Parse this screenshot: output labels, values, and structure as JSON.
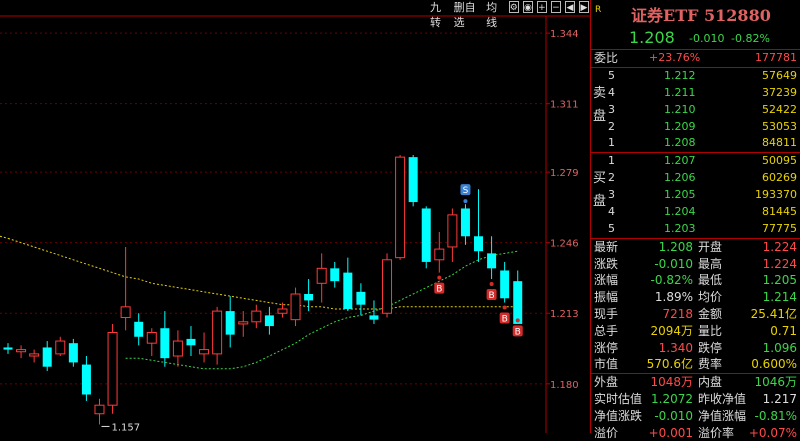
{
  "toolbar": {
    "items": [
      "九转",
      "删自选",
      "均线"
    ]
  },
  "chart_data": {
    "type": "candlestick",
    "y_ticks": [
      "1.344",
      "1.311",
      "1.279",
      "1.246",
      "1.213",
      "1.180"
    ],
    "ylim": [
      1.157,
      1.352
    ],
    "low_annotation": "1.157",
    "candles": [
      {
        "o": 1.197,
        "h": 1.199,
        "l": 1.194,
        "c": 1.196
      },
      {
        "o": 1.195,
        "h": 1.198,
        "l": 1.192,
        "c": 1.196
      },
      {
        "o": 1.193,
        "h": 1.196,
        "l": 1.19,
        "c": 1.194
      },
      {
        "o": 1.197,
        "h": 1.2,
        "l": 1.186,
        "c": 1.188
      },
      {
        "o": 1.194,
        "h": 1.202,
        "l": 1.193,
        "c": 1.2
      },
      {
        "o": 1.199,
        "h": 1.201,
        "l": 1.188,
        "c": 1.19
      },
      {
        "o": 1.189,
        "h": 1.193,
        "l": 1.172,
        "c": 1.175
      },
      {
        "o": 1.166,
        "h": 1.173,
        "l": 1.161,
        "c": 1.17
      },
      {
        "o": 1.17,
        "h": 1.208,
        "l": 1.166,
        "c": 1.204
      },
      {
        "o": 1.211,
        "h": 1.244,
        "l": 1.205,
        "c": 1.216
      },
      {
        "o": 1.209,
        "h": 1.213,
        "l": 1.198,
        "c": 1.202
      },
      {
        "o": 1.199,
        "h": 1.206,
        "l": 1.193,
        "c": 1.204
      },
      {
        "o": 1.206,
        "h": 1.214,
        "l": 1.188,
        "c": 1.192
      },
      {
        "o": 1.193,
        "h": 1.205,
        "l": 1.188,
        "c": 1.2
      },
      {
        "o": 1.201,
        "h": 1.207,
        "l": 1.193,
        "c": 1.198
      },
      {
        "o": 1.194,
        "h": 1.204,
        "l": 1.19,
        "c": 1.196
      },
      {
        "o": 1.194,
        "h": 1.216,
        "l": 1.189,
        "c": 1.214
      },
      {
        "o": 1.214,
        "h": 1.221,
        "l": 1.197,
        "c": 1.203
      },
      {
        "o": 1.208,
        "h": 1.214,
        "l": 1.202,
        "c": 1.209
      },
      {
        "o": 1.209,
        "h": 1.217,
        "l": 1.206,
        "c": 1.214
      },
      {
        "o": 1.212,
        "h": 1.216,
        "l": 1.203,
        "c": 1.207
      },
      {
        "o": 1.213,
        "h": 1.218,
        "l": 1.211,
        "c": 1.215
      },
      {
        "o": 1.21,
        "h": 1.225,
        "l": 1.207,
        "c": 1.222
      },
      {
        "o": 1.222,
        "h": 1.229,
        "l": 1.214,
        "c": 1.219
      },
      {
        "o": 1.227,
        "h": 1.241,
        "l": 1.218,
        "c": 1.234
      },
      {
        "o": 1.234,
        "h": 1.237,
        "l": 1.225,
        "c": 1.228
      },
      {
        "o": 1.232,
        "h": 1.239,
        "l": 1.214,
        "c": 1.215
      },
      {
        "o": 1.223,
        "h": 1.227,
        "l": 1.212,
        "c": 1.217
      },
      {
        "o": 1.212,
        "h": 1.219,
        "l": 1.208,
        "c": 1.21
      },
      {
        "o": 1.213,
        "h": 1.241,
        "l": 1.211,
        "c": 1.238
      },
      {
        "o": 1.239,
        "h": 1.287,
        "l": 1.238,
        "c": 1.286
      },
      {
        "o": 1.286,
        "h": 1.287,
        "l": 1.263,
        "c": 1.265
      },
      {
        "o": 1.262,
        "h": 1.263,
        "l": 1.234,
        "c": 1.237
      },
      {
        "o": 1.238,
        "h": 1.251,
        "l": 1.232,
        "c": 1.243
      },
      {
        "o": 1.244,
        "h": 1.262,
        "l": 1.237,
        "c": 1.259
      },
      {
        "o": 1.262,
        "h": 1.264,
        "l": 1.245,
        "c": 1.249
      },
      {
        "o": 1.249,
        "h": 1.271,
        "l": 1.237,
        "c": 1.242
      },
      {
        "o": 1.241,
        "h": 1.249,
        "l": 1.229,
        "c": 1.234
      },
      {
        "o": 1.233,
        "h": 1.237,
        "l": 1.218,
        "c": 1.22
      },
      {
        "o": 1.228,
        "h": 1.233,
        "l": 1.212,
        "c": 1.208
      }
    ],
    "ma_yellow": [
      1.248,
      1.246,
      1.244,
      1.242,
      1.24,
      1.238,
      1.236,
      1.234,
      1.232,
      1.23,
      1.229,
      1.227,
      1.226,
      1.225,
      1.224,
      1.223,
      1.222,
      1.221,
      1.22,
      1.219,
      1.218,
      1.217,
      1.217,
      1.216,
      1.216,
      1.215,
      1.215,
      1.215,
      1.215,
      1.215,
      1.216,
      1.216,
      1.216,
      1.216,
      1.216,
      1.216,
      1.216,
      1.216,
      1.216,
      1.216
    ],
    "ma_green": [
      null,
      null,
      null,
      null,
      null,
      null,
      null,
      null,
      null,
      1.192,
      1.192,
      1.191,
      1.19,
      1.189,
      1.188,
      1.187,
      1.187,
      1.187,
      1.188,
      1.19,
      1.193,
      1.196,
      1.199,
      1.203,
      1.206,
      1.209,
      1.211,
      1.212,
      1.214,
      1.216,
      1.219,
      1.222,
      1.225,
      1.228,
      1.231,
      1.235,
      1.238,
      1.24,
      1.241,
      1.242
    ],
    "markers": [
      {
        "index": 35,
        "label": "S",
        "color": "#3a7fd0"
      },
      {
        "index": 33,
        "label": "B",
        "color": "#d32a2a",
        "dot_offset": -1
      },
      {
        "index": 37,
        "label": "B",
        "color": "#d32a2a"
      },
      {
        "index": 38,
        "label": "B",
        "color": "#d32a2a"
      },
      {
        "index": 39,
        "label": "B",
        "color": "#d32a2a"
      }
    ]
  },
  "panel": {
    "r_mark": "R",
    "title": "证券ETF 512880",
    "price": "1.208",
    "change": "-0.010",
    "change_pct": "-0.82%",
    "weibi": {
      "label": "委比",
      "pct": "+23.76%",
      "diff": "177781"
    },
    "sell_label": "卖盘",
    "buy_label": "买盘",
    "asks": [
      {
        "level": "5",
        "price": "1.212",
        "vol": "57649"
      },
      {
        "level": "4",
        "price": "1.211",
        "vol": "37239"
      },
      {
        "level": "3",
        "price": "1.210",
        "vol": "52422"
      },
      {
        "level": "2",
        "price": "1.209",
        "vol": "53053"
      },
      {
        "level": "1",
        "price": "1.208",
        "vol": "84811"
      }
    ],
    "bids": [
      {
        "level": "1",
        "price": "1.207",
        "vol": "50095"
      },
      {
        "level": "2",
        "price": "1.206",
        "vol": "60269"
      },
      {
        "level": "3",
        "price": "1.205",
        "vol": "193370"
      },
      {
        "level": "4",
        "price": "1.204",
        "vol": "81445"
      },
      {
        "level": "5",
        "price": "1.203",
        "vol": "77775"
      }
    ],
    "stats": [
      {
        "k1": "最新",
        "v1": "1.208",
        "c1": "g",
        "k2": "开盘",
        "v2": "1.224",
        "c2": "r"
      },
      {
        "k1": "涨跌",
        "v1": "-0.010",
        "c1": "g",
        "k2": "最高",
        "v2": "1.224",
        "c2": "r"
      },
      {
        "k1": "涨幅",
        "v1": "-0.82%",
        "c1": "g",
        "k2": "最低",
        "v2": "1.205",
        "c2": "g"
      },
      {
        "k1": "振幅",
        "v1": "1.89%",
        "c1": "w",
        "k2": "均价",
        "v2": "1.214",
        "c2": "g"
      },
      {
        "k1": "现手",
        "v1": "7218",
        "c1": "r",
        "k2": "金额",
        "v2": "25.41亿",
        "c2": "y"
      },
      {
        "k1": "总手",
        "v1": "2094万",
        "c1": "y",
        "k2": "量比",
        "v2": "0.71",
        "c2": "y"
      },
      {
        "k1": "涨停",
        "v1": "1.340",
        "c1": "r",
        "k2": "跌停",
        "v2": "1.096",
        "c2": "g"
      },
      {
        "k1": "市值",
        "v1": "570.6亿",
        "c1": "y",
        "k2": "费率",
        "v2": "0.600%",
        "c2": "y"
      },
      {
        "k1": "外盘",
        "v1": "1048万",
        "c1": "r",
        "k2": "内盘",
        "v2": "1046万",
        "c2": "g"
      },
      {
        "k1": "实时估值",
        "v1": "1.2072",
        "c1": "g",
        "k2": "昨收净值",
        "v2": "1.217",
        "c2": "w"
      },
      {
        "k1": "净值涨跌",
        "v1": "-0.010",
        "c1": "g",
        "k2": "净值涨幅",
        "v2": "-0.81%",
        "c2": "g"
      },
      {
        "k1": "溢价",
        "v1": "+0.001",
        "c1": "r",
        "k2": "溢价率",
        "v2": "+0.07%",
        "c2": "r"
      }
    ]
  }
}
